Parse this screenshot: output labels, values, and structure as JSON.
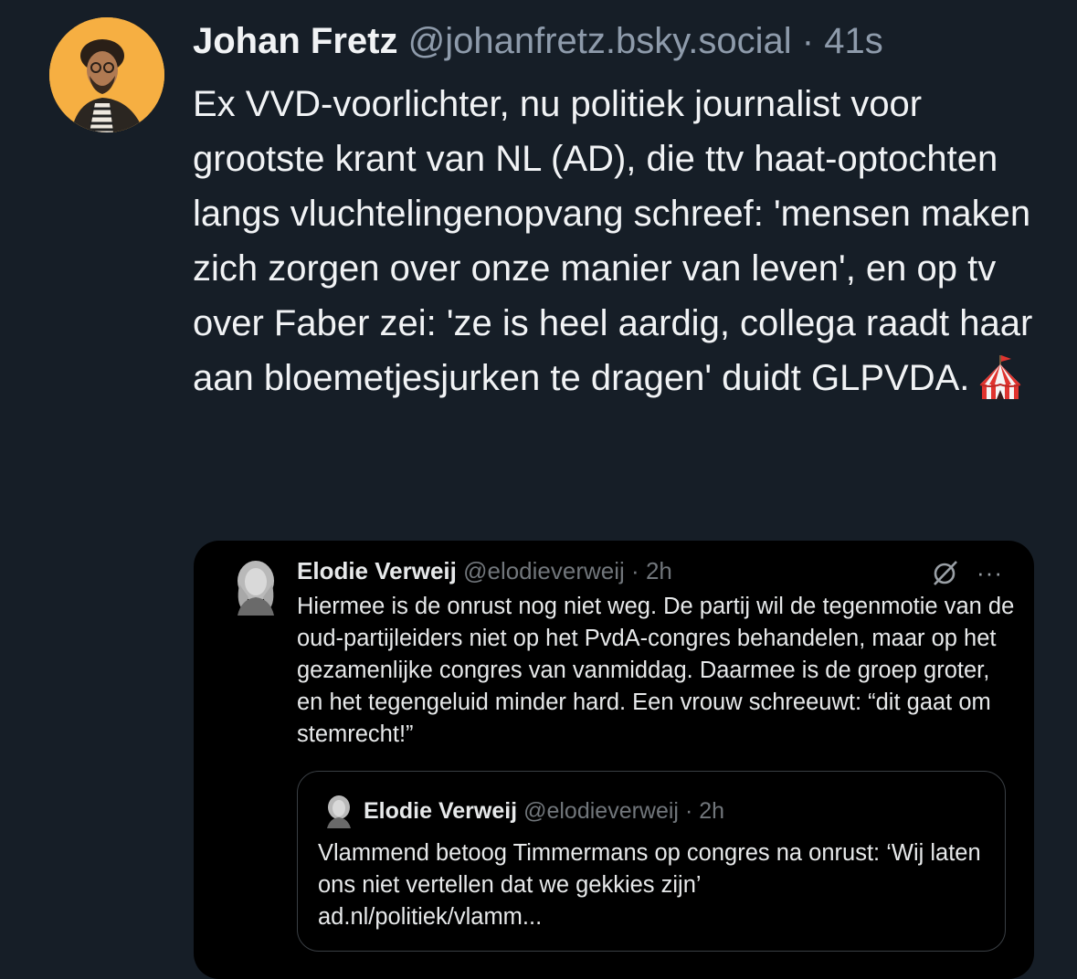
{
  "post": {
    "author_name": "Johan Fretz",
    "author_handle": "@johanfretz.bsky.social",
    "separator": "·",
    "time": "41s",
    "text": "Ex VVD-voorlichter, nu politiek journalist voor grootste krant van NL (AD), die ttv haat-optochten langs vluchtelingenopvang schreef: 'mensen maken zich zorgen over onze manier van leven', en op tv over Faber zei: 'ze is heel aardig, collega raadt haar aan bloemetjesjurken te dragen' duidt GLPVDA.",
    "emoji_icon": "circus-tent-icon"
  },
  "embed": {
    "author_name": "Elodie Verweij",
    "author_handle": "@elodieverweij",
    "separator": "·",
    "time": "2h",
    "text": "Hiermee is de onrust nog niet weg. De partij wil de tegenmotie van de oud-partijleiders niet op het PvdA-congres behandelen, maar op het gezamenlijke congres van vanmiddag. Daarmee is de groep groter, en het tegengeluid minder hard. Een vrouw schreeuwt: “dit gaat om stemrecht!”",
    "more_label": "···",
    "quoted": {
      "author_name": "Elodie Verweij",
      "author_handle": "@elodieverweij",
      "separator": "·",
      "time": "2h",
      "text": "Vlammend betoog Timmermans op congres na onrust: ‘Wij laten ons niet vertellen dat we gekkies zijn’",
      "link": "ad.nl/politiek/vlamm..."
    }
  },
  "colors": {
    "background": "#161e27",
    "text": "#f1f3f5",
    "muted": "#8e9bab",
    "embed_bg": "#000000",
    "avatar_bg": "#f4a93c"
  }
}
